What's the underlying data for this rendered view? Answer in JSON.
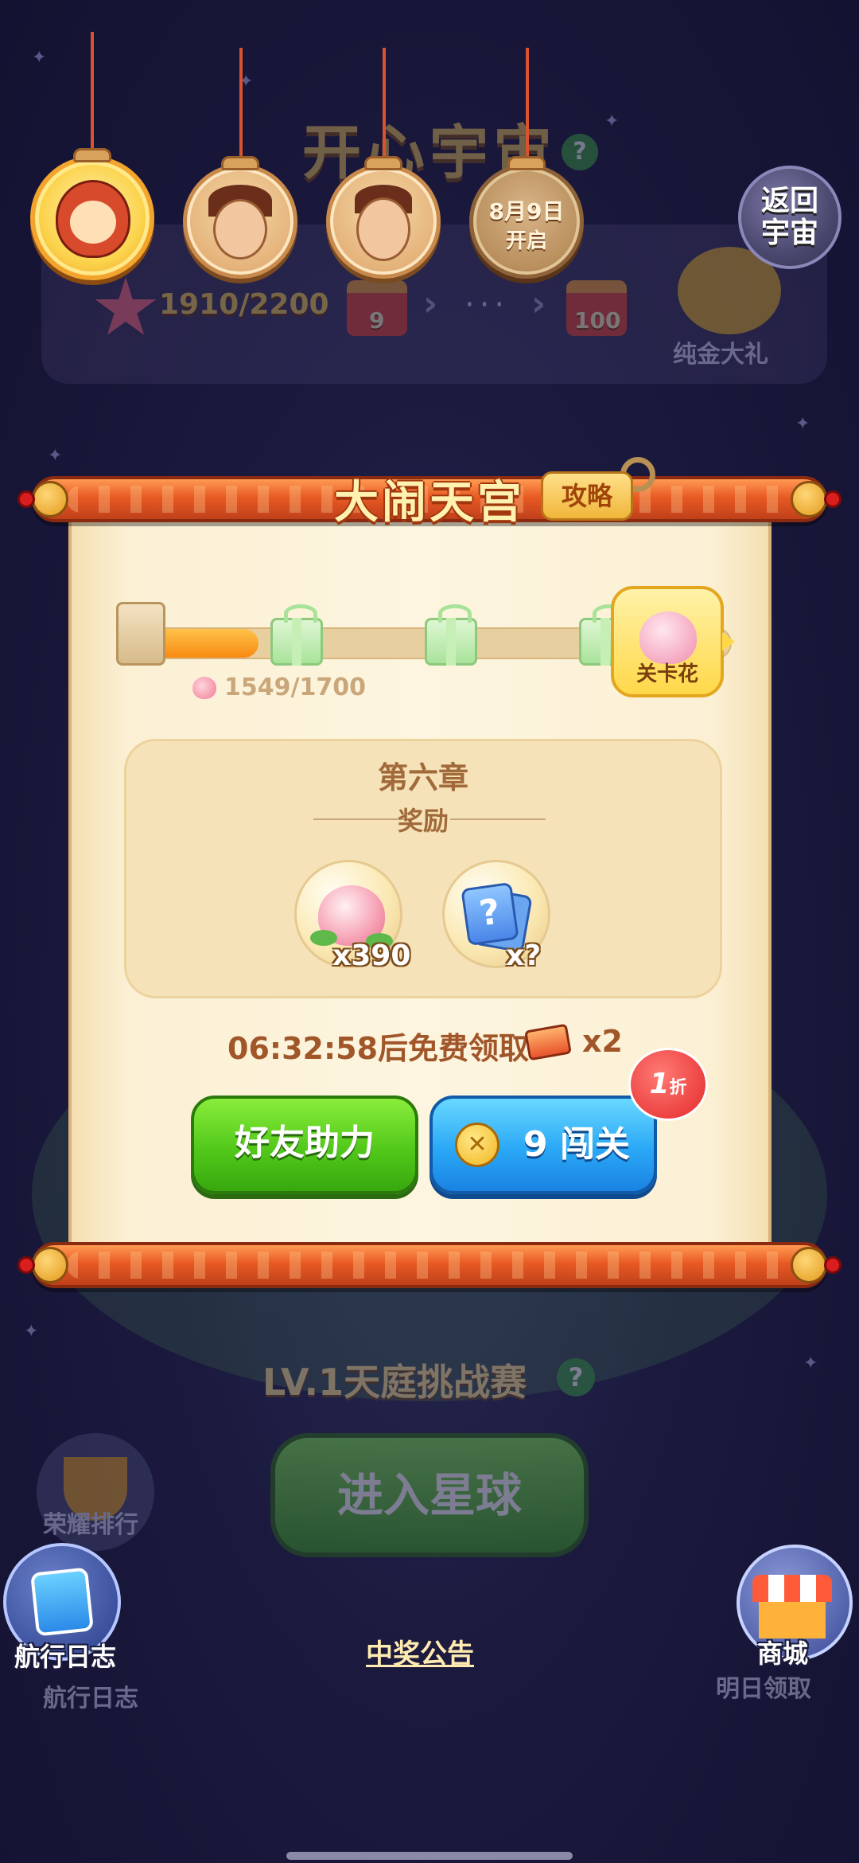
{
  "background": {
    "title": "开心宇宙",
    "progress_text": "1910/2200",
    "gift_labels": [
      "9",
      "100"
    ],
    "dots": "···",
    "gold_gift_label": "纯金大礼",
    "level_title": "LV.1天庭挑战赛",
    "enter_button": "进入星球",
    "left_labels": [
      "荣耀排行",
      "航行日志"
    ],
    "right_label": "明日领取"
  },
  "top_bar": {
    "locked_medal_date": "8月9日",
    "locked_medal_sub": "开启",
    "return_button": "返回宇宙"
  },
  "dialog": {
    "title": "大闹天宫",
    "guide_button": "攻略",
    "progress_text": "1549/1700",
    "progress_current": 1549,
    "progress_total": 1700,
    "level_flower_label": "关卡花",
    "chapter_title": "第六章",
    "reward_label": "奖励",
    "rewards": [
      {
        "icon": "peach-icon",
        "count": "x390"
      },
      {
        "icon": "mystery-card-icon",
        "count": "x?"
      }
    ],
    "timer_text": "06:32:58后免费领取",
    "ticket_count": "x2",
    "friend_help_button": "好友助力",
    "pass_button_cost": "9",
    "pass_button_label": "9 闯关",
    "discount_number": "1",
    "discount_unit": "折"
  },
  "bottom": {
    "log_label": "航行日志",
    "shop_label": "商城",
    "notice_link": "中奖公告"
  },
  "colors": {
    "background": "#1b1a3e",
    "rod": "#e85a24",
    "paper": "#fdf5df",
    "green_button": "#52c81a",
    "blue_button": "#2aa8f6",
    "text_brown": "#a1562a"
  }
}
